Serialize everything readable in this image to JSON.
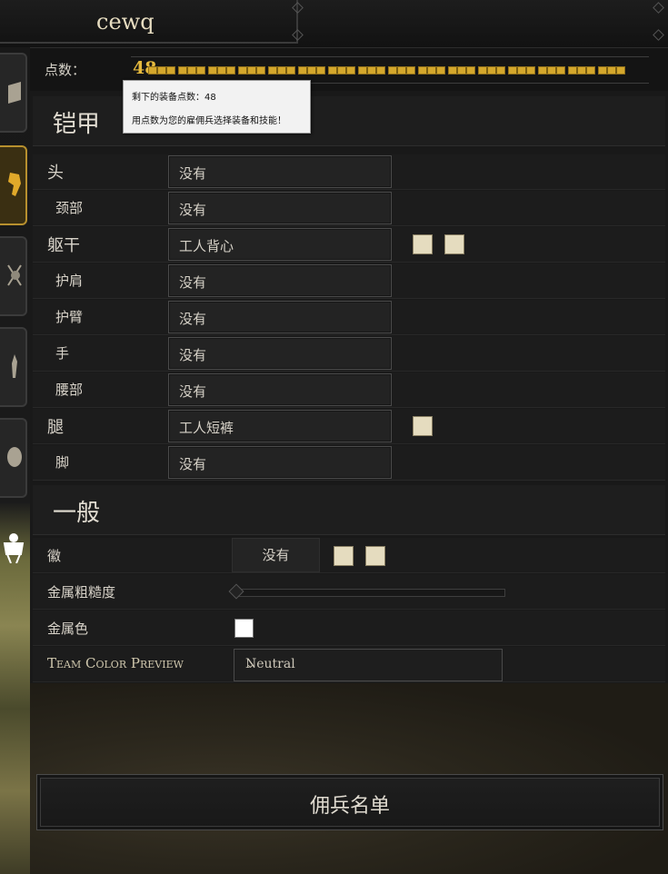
{
  "window": {
    "title": "cewq"
  },
  "points": {
    "label": "点数：",
    "value": "48",
    "pip_count": 16
  },
  "tooltip": {
    "line1": "剩下的装备点数：48",
    "line2": "用点数为您的雇佣兵选择装备和技能！"
  },
  "armor": {
    "title": "铠甲",
    "rows": [
      {
        "label": "头",
        "value": "没有",
        "swatches": 0
      },
      {
        "label": "颈部",
        "value": "没有",
        "swatches": 0
      },
      {
        "label": "躯干",
        "value": "工人背心",
        "swatches": 2
      },
      {
        "label": "护肩",
        "value": "没有",
        "swatches": 0
      },
      {
        "label": "护臂",
        "value": "没有",
        "swatches": 0
      },
      {
        "label": "手",
        "value": "没有",
        "swatches": 0
      },
      {
        "label": "腰部",
        "value": "没有",
        "swatches": 0
      },
      {
        "label": "腿",
        "value": "工人短裤",
        "swatches": 1
      },
      {
        "label": "脚",
        "value": "没有",
        "swatches": 0
      }
    ]
  },
  "general": {
    "title": "一般",
    "emblem": {
      "label": "徽",
      "value": "没有"
    },
    "roughness": {
      "label": "金属粗糙度",
      "level": 0
    },
    "metal_color": {
      "label": "金属色",
      "color": "#ffffff"
    },
    "team_color": {
      "label": "Team Color Preview",
      "value": "Neutral"
    }
  },
  "roster_button": {
    "label": "佣兵名单"
  },
  "colors": {
    "accent_gold": "#d4a72c",
    "swatch": "#e5dcbf"
  },
  "left_tabs": [
    "map-icon",
    "armor-icon",
    "weapons-icon",
    "skills-icon",
    "head-icon"
  ]
}
